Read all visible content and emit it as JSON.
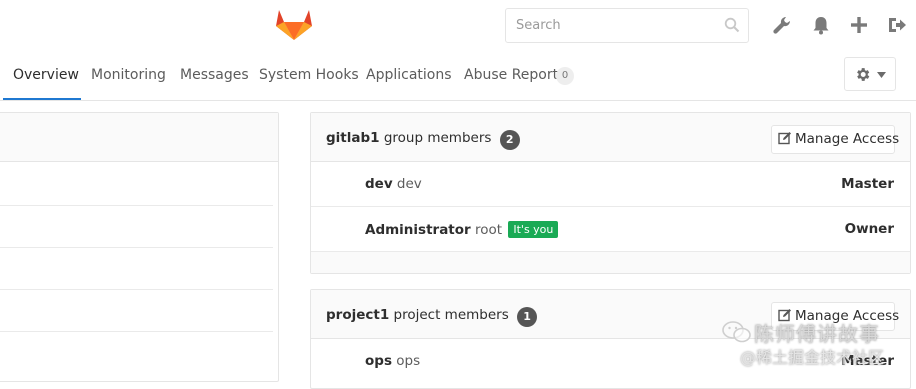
{
  "header": {
    "search_placeholder": "Search"
  },
  "nav": {
    "tabs": [
      {
        "label": "Overview",
        "active": true
      },
      {
        "label": "Monitoring"
      },
      {
        "label": "Messages"
      },
      {
        "label": "System Hooks"
      },
      {
        "label": "Applications"
      },
      {
        "label": "Abuse Reports",
        "badge": "0"
      }
    ]
  },
  "group_panel": {
    "name": "gitlab1",
    "title_suffix": "group members",
    "count": "2",
    "manage_label": "Manage Access",
    "members": [
      {
        "name": "dev",
        "username": "dev",
        "role": "Master"
      },
      {
        "name": "Administrator",
        "username": "root",
        "badge": "It's you",
        "role": "Owner"
      }
    ]
  },
  "project_panel": {
    "name": "project1",
    "title_suffix": "project members",
    "count": "1",
    "manage_label": "Manage Access",
    "members": [
      {
        "name": "ops",
        "username": "ops",
        "role": "Master"
      }
    ]
  },
  "watermark": {
    "line1": "陈师傅讲故事",
    "line2": "@稀土掘金技术社区"
  },
  "colors": {
    "accent": "#1f78d1",
    "badge_green": "#1aaa55",
    "logo_orange": "#e24329",
    "logo_light": "#fca326"
  }
}
